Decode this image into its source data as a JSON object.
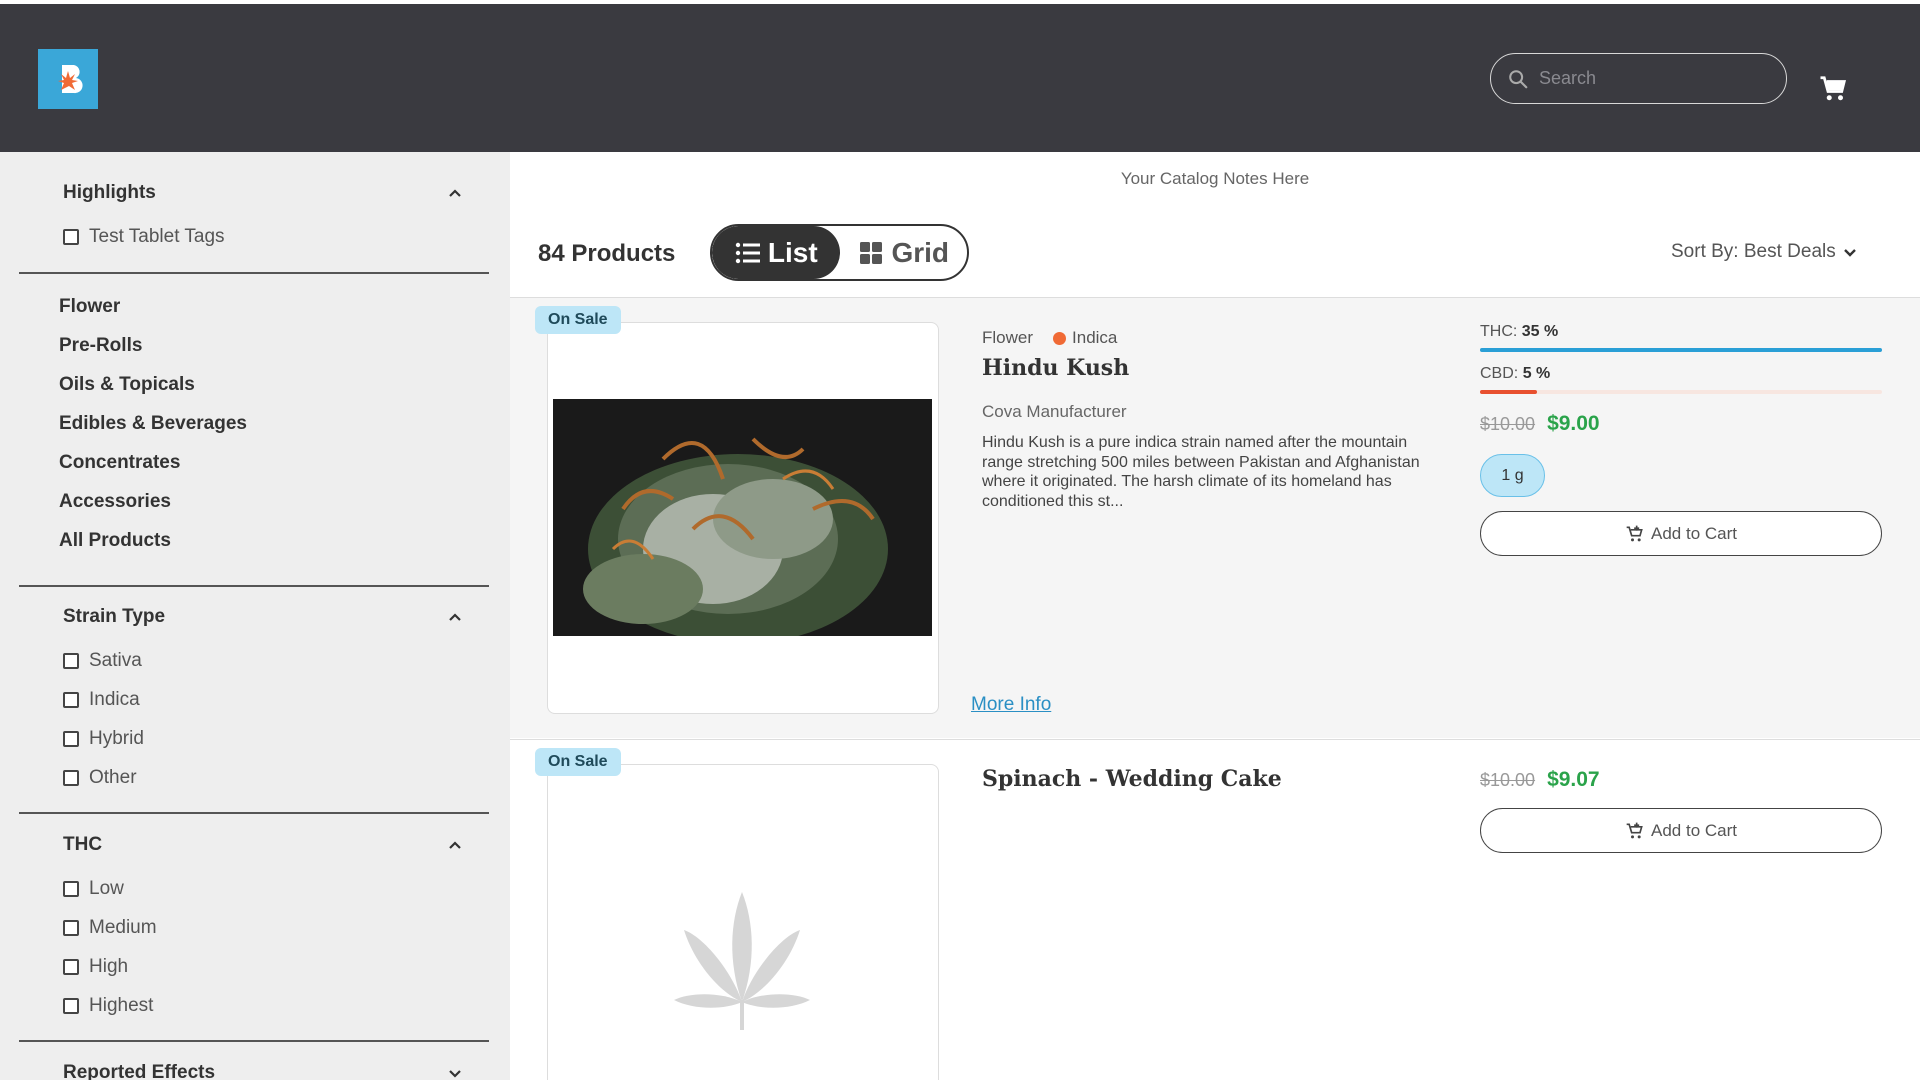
{
  "header": {
    "logo_icon": "brand-logo-icon",
    "search": {
      "placeholder": "Search"
    },
    "cart_icon": "cart-icon"
  },
  "sidebar": {
    "highlights": {
      "title": "Highlights",
      "items": [
        "Test Tablet Tags"
      ]
    },
    "categories": [
      "Flower",
      "Pre-Rolls",
      "Oils & Topicals",
      "Edibles & Beverages",
      "Concentrates",
      "Accessories",
      "All Products"
    ],
    "strain_type": {
      "title": "Strain Type",
      "items": [
        "Sativa",
        "Indica",
        "Hybrid",
        "Other"
      ]
    },
    "thc": {
      "title": "THC",
      "items": [
        "Low",
        "Medium",
        "High",
        "Highest"
      ]
    },
    "reported_effects": {
      "title": "Reported Effects"
    }
  },
  "main": {
    "catalog_notes": "Your Catalog Notes Here",
    "product_count": "84 Products",
    "view_toggle": {
      "list": "List",
      "grid": "Grid",
      "active": "list"
    },
    "sort_by": "Sort By: Best Deals",
    "products": [
      {
        "badge": "On Sale",
        "category": "Flower",
        "strain": "Indica",
        "strain_color": "#f06a35",
        "name": "Hindu Kush",
        "manufacturer": "Cova Manufacturer",
        "description": "Hindu Kush is a pure indica strain named after the mountain range stretching 500 miles between Pakistan and Afghanistan where it originated. The harsh climate of its homeland has conditioned this st...",
        "thc_label": "THC:",
        "thc_value": "35 %",
        "thc_fraction": 0.35,
        "cbd_label": "CBD:",
        "cbd_value": "5 %",
        "cbd_fraction": 0.05,
        "old_price": "$10.00",
        "new_price": "$9.00",
        "size": "1 g",
        "add_to_cart": "Add to Cart",
        "more_info": "More Info"
      },
      {
        "badge": "On Sale",
        "name": "Spinach - Wedding Cake",
        "old_price": "$10.00",
        "new_price": "$9.07",
        "add_to_cart": "Add to Cart"
      }
    ]
  },
  "colors": {
    "header_bg": "#3a3a40",
    "logo_bg": "#3aa7d8",
    "sale_badge_bg": "#bde6f7",
    "price_green": "#2aa34a",
    "thc_bar": "#2a9fd6",
    "cbd_bar": "#e8502f",
    "link_blue": "#2a8fc4"
  }
}
